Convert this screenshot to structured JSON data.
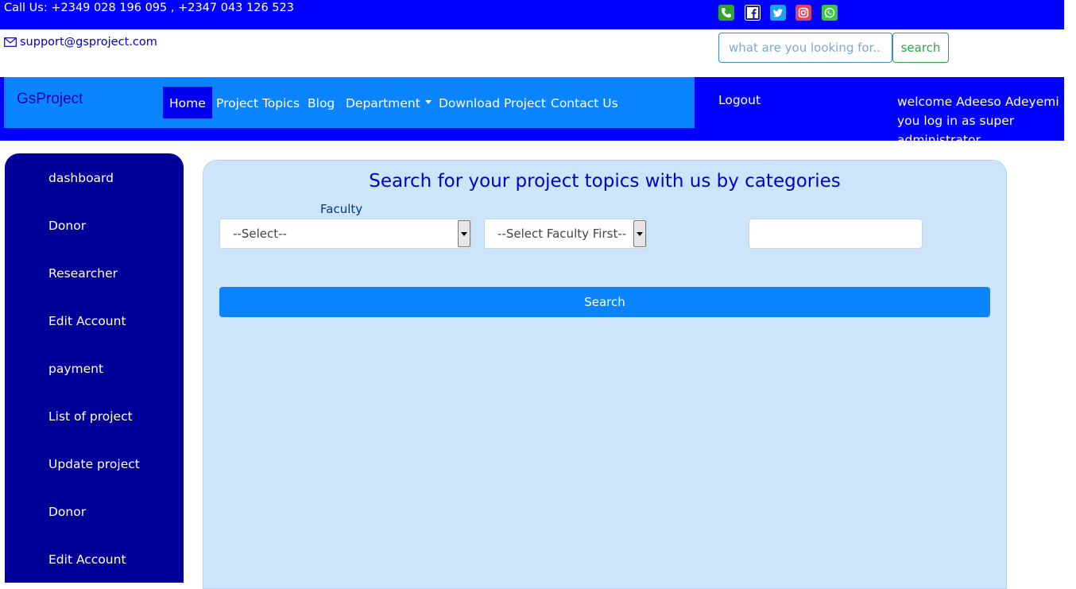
{
  "topbar": {
    "phone_text": "Call Us: +2349 028 196 095 , +2347 043 126 523",
    "social_icons": [
      {
        "name": "phone-icon",
        "color": "#2fa52f"
      },
      {
        "name": "facebook-icon",
        "color": "#ffffff"
      },
      {
        "name": "twitter-icon",
        "color": "#1da1f2"
      },
      {
        "name": "instagram-icon",
        "color": "#e4405f"
      },
      {
        "name": "whatsapp-icon",
        "color": "#3cc546"
      }
    ]
  },
  "contact": {
    "email": "support@gsproject.com"
  },
  "search": {
    "placeholder": "what are you looking for..",
    "button_label": "search"
  },
  "nav": {
    "brand": "GsProject",
    "links": [
      "Home",
      "Project Topics",
      "Blog",
      "Department",
      "Download Project",
      "Contact Us"
    ],
    "active": "Home",
    "logout": "Logout",
    "welcome": "welcome Adeeso Adeyemi you log in as super administrator"
  },
  "sidebar": {
    "items": [
      "dashboard",
      "Donor",
      "Researcher",
      "Edit Account",
      "payment",
      "List of project",
      "Update project",
      "Donor",
      "Edit Account"
    ]
  },
  "main": {
    "title": "Search for your project topics with us by categories",
    "faculty_label": "Faculty",
    "faculty_select": "--Select--",
    "department_select": "--Select Faculty First--",
    "search_button": "Search"
  },
  "colors": {
    "primary_blue": "#0000ff",
    "nav_light_blue": "#0a84ff",
    "sidebar_navy": "#000099",
    "panel_bg": "#cce5fb",
    "green_accent": "#28a745"
  }
}
